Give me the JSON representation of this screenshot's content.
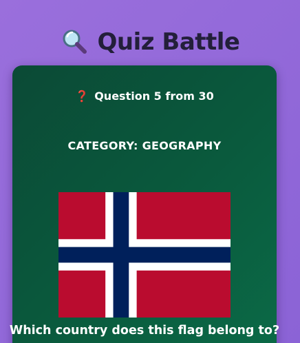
{
  "app": {
    "title": "Quiz Battle",
    "icon": "magnifying-glass-icon"
  },
  "quiz": {
    "progress_text": "Question 5 from 30",
    "progress_icon": "question-mark-icon",
    "category_text": "CATEGORY: GEOGRAPHY",
    "question_text": "Which country does this flag belong to?",
    "flag": {
      "icon": "norway-flag",
      "colors": {
        "field": "#ba0c2f",
        "cross_outline": "#ffffff",
        "cross": "#00205b"
      }
    }
  },
  "colors": {
    "background": "#9068d8",
    "card": "#0a5a3d",
    "title_text": "#231f3a",
    "text": "#ffffff",
    "qmark": "#e0314b"
  }
}
